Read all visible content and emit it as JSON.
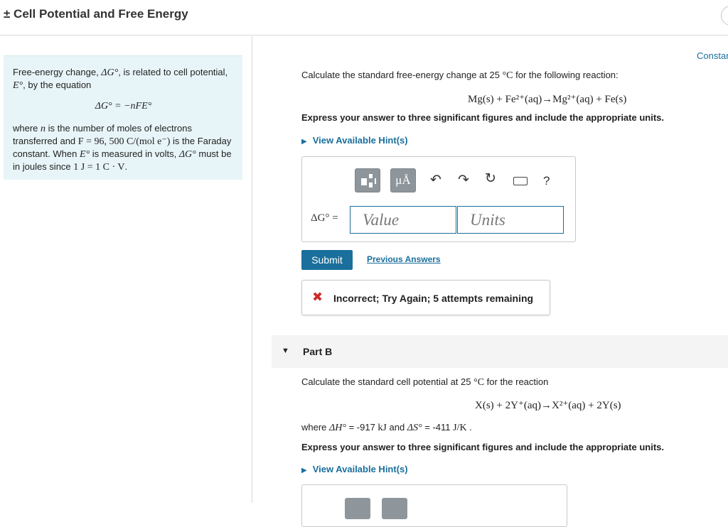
{
  "header": {
    "title": "± Cell Potential and Free Energy",
    "constants_link": "Constar"
  },
  "intro": {
    "line1_pre": "Free-energy change, ",
    "dg_sym": "ΔG°",
    "line1_post": ", is related to cell potential, ",
    "e_sym": "E°",
    "line1_end": ", by the equation",
    "equation": "ΔG° = −nFE°",
    "where_pre": "where ",
    "n_sym": "n",
    "where_mid1": " is the number of moles of electrons transferred and ",
    "f_def": "F = 96, 500 C/(mol e⁻)",
    "where_mid2": " is the Faraday constant. When ",
    "e_sym2": "E°",
    "where_mid3": " is measured in volts, ",
    "dg_sym2": "ΔG°",
    "where_mid4": " must be in joules since ",
    "unit_def": "1 J = 1 C · V",
    "where_end": "."
  },
  "part_a": {
    "prompt_pre": "Calculate the standard free-energy change at 25 ",
    "temp_unit": "°C",
    "prompt_post": " for the following reaction:",
    "reaction": "Mg(s) + Fe²⁺(aq)→Mg²⁺(aq) + Fe(s)",
    "instructions": "Express your answer to three significant figures and include the appropriate units.",
    "hint_label": "View Available Hint(s)",
    "toolbar": {
      "units_label": "μÅ",
      "undo": "↶",
      "redo": "↷",
      "reset": "↻",
      "help": "?"
    },
    "answer_label": "ΔG° =",
    "value_placeholder": "Value",
    "units_placeholder": "Units",
    "submit_label": "Submit",
    "previous_answers": "Previous Answers",
    "feedback": "Incorrect; Try Again; 5 attempts remaining",
    "feedback_icon": "✖"
  },
  "part_b": {
    "title": "Part B",
    "prompt_pre": "Calculate the standard cell potential at 25 ",
    "temp_unit": "°C",
    "prompt_post": " for the reaction",
    "reaction": "X(s) + 2Y⁺(aq)→X²⁺(aq) + 2Y(s)",
    "where_pre": "where ",
    "dh_sym": "ΔH°",
    "dh_val": " = -917 ",
    "dh_unit": "kJ",
    "and": " and ",
    "ds_sym": "ΔS°",
    "ds_val": " = -411 ",
    "ds_unit": "J/K",
    "period": " .",
    "instructions": "Express your answer to three significant figures and include the appropriate units.",
    "hint_label": "View Available Hint(s)"
  },
  "colors": {
    "accent": "#1a6f9c",
    "intro_bg": "#e8f5f8",
    "error": "#cc2a2a"
  }
}
